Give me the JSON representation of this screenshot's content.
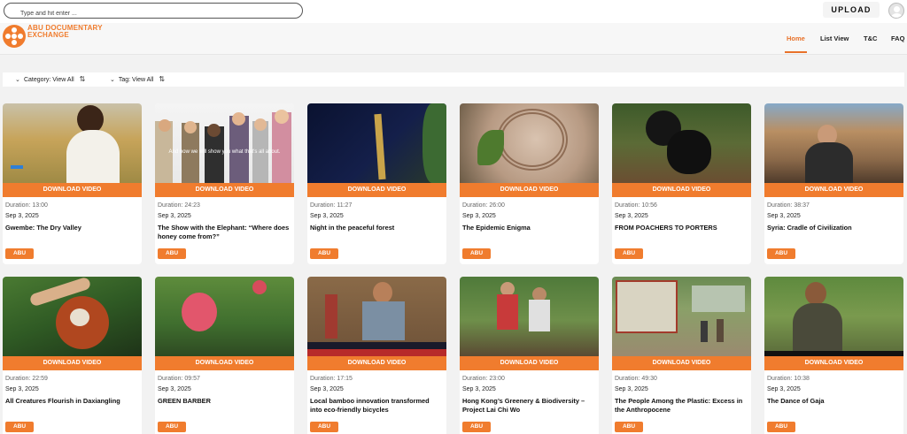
{
  "search": {
    "placeholder": "Type and hit enter ..."
  },
  "header": {
    "upload_label": "UPLOAD",
    "logo_text": "ABU DOCUMENTARY EXCHANGE",
    "nav": [
      "Home",
      "List View",
      "T&C",
      "FAQ"
    ],
    "active_nav": "Home"
  },
  "filters": {
    "category": "Category: View All",
    "tag": "Tag: View All"
  },
  "card_common": {
    "download_label": "DOWNLOAD VIDEO"
  },
  "videos": [
    {
      "duration": "Duration: 13:00",
      "date": "Sep 3, 2025",
      "title": "Gwembe: The Dry Valley",
      "badge": "ABU",
      "caption": ""
    },
    {
      "duration": "Duration: 24:23",
      "date": "Sep 3, 2025",
      "title": "The Show with the Elephant: “Where does honey come from?”",
      "badge": "ABU",
      "caption": "And now we will show you what that's all about."
    },
    {
      "duration": "Duration: 11:27",
      "date": "Sep 3, 2025",
      "title": "Night in the peaceful forest",
      "badge": "ABU",
      "caption": ""
    },
    {
      "duration": "Duration: 26:00",
      "date": "Sep 3, 2025",
      "title": "The Epidemic Enigma",
      "badge": "ABU",
      "caption": ""
    },
    {
      "duration": "Duration: 10:56",
      "date": "Sep 3, 2025",
      "title": "FROM POACHERS TO PORTERS",
      "badge": "ABU",
      "caption": ""
    },
    {
      "duration": "Duration: 38:37",
      "date": "Sep 3, 2025",
      "title": "Syria: Cradle of Civilization",
      "badge": "ABU",
      "caption": ""
    },
    {
      "duration": "Duration: 22:59",
      "date": "Sep 3, 2025",
      "title": "All Creatures Flourish in Daxiangling",
      "badge": "ABU",
      "caption": ""
    },
    {
      "duration": "Duration: 09:57",
      "date": "Sep 3, 2025",
      "title": "GREEN BARBER",
      "badge": "ABU",
      "caption": ""
    },
    {
      "duration": "Duration: 17:15",
      "date": "Sep 3, 2025",
      "title": "Local bamboo innovation transformed into eco-friendly bicycles",
      "badge": "ABU",
      "caption": ""
    },
    {
      "duration": "Duration: 23:00",
      "date": "Sep 3, 2025",
      "title": "Hong Kong’s Greenery & Biodiversity – Project Lai Chi Wo",
      "badge": "ABU",
      "caption": ""
    },
    {
      "duration": "Duration: 49:30",
      "date": "Sep 3, 2025",
      "title": "The People Among the Plastic: Excess in the Anthropocene",
      "badge": "ABU",
      "caption": ""
    },
    {
      "duration": "Duration: 10:38",
      "date": "Sep 3, 2025",
      "title": "The Dance of Gaja",
      "badge": "ABU",
      "caption": ""
    }
  ],
  "colors": {
    "accent": "#f07c2e",
    "active_nav": "#e8722a"
  }
}
